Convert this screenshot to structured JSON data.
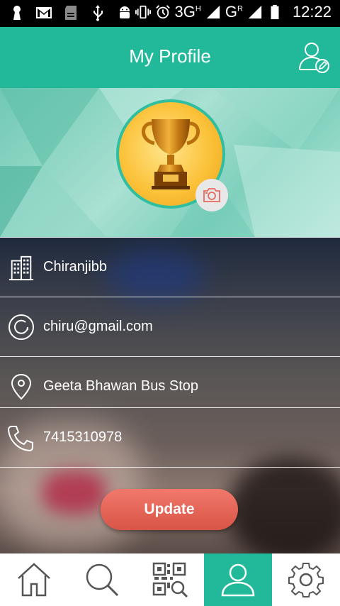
{
  "status_bar": {
    "time": "12:22",
    "network_1": "3G",
    "network_1_sup": "H",
    "network_2": "G",
    "network_2_sup": "R",
    "icons": [
      "keyhole-icon",
      "gmail-icon",
      "sd-card-icon",
      "usb-icon",
      "android-icon",
      "vibrate-icon",
      "alarm-icon",
      "signal-icon",
      "battery-icon"
    ]
  },
  "header": {
    "title": "My Profile",
    "edit_icon": "edit-profile-icon"
  },
  "profile": {
    "avatar": "trophy-image",
    "camera_icon": "camera-icon"
  },
  "fields": [
    {
      "icon": "building-icon",
      "value": "Chiranjibb"
    },
    {
      "icon": "at-sign-icon",
      "value": "chiru@gmail.com"
    },
    {
      "icon": "location-pin-icon",
      "value": "Geeta Bhawan Bus Stop"
    },
    {
      "icon": "phone-icon",
      "value": "7415310978"
    }
  ],
  "update_label": "Update",
  "colors": {
    "accent": "#22b99a",
    "button": "#e0604f",
    "nav_bg": "#ffffff"
  },
  "bottom_nav": {
    "items": [
      "home-icon",
      "search-icon",
      "qr-scan-icon",
      "profile-icon",
      "settings-icon"
    ],
    "active": "profile-icon"
  }
}
